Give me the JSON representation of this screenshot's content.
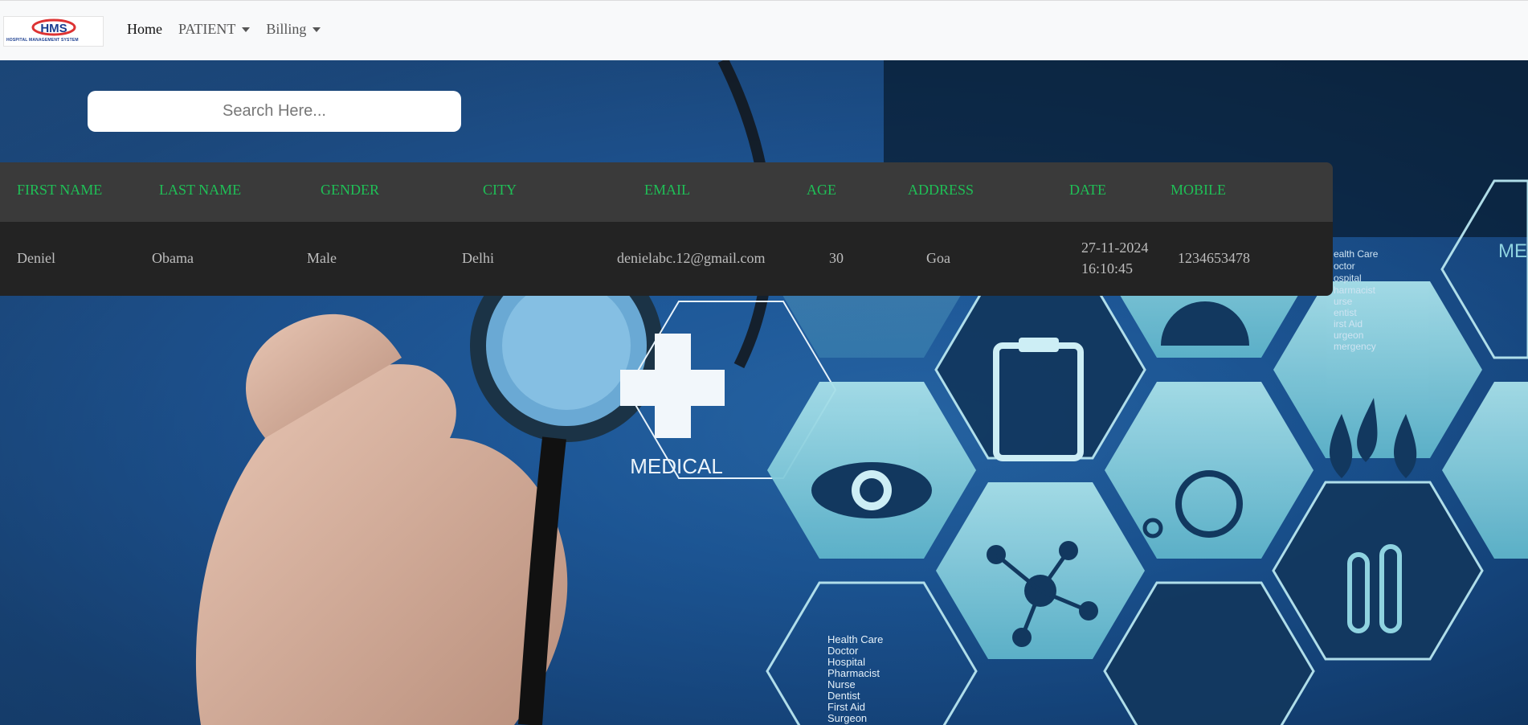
{
  "nav": {
    "logo_text": "HMS",
    "logo_tagline": "HOSPITAL MANAGEMENT SYSTEM",
    "items": [
      {
        "label": "Home"
      },
      {
        "label": "PATIENT"
      },
      {
        "label": "Billing"
      }
    ]
  },
  "search": {
    "placeholder": "Search Here..."
  },
  "table": {
    "headers": [
      "FIRST NAME",
      "LAST NAME",
      "GENDER",
      "CITY",
      "EMAIL",
      "AGE",
      "ADDRESS",
      "DATE",
      "MOBILE"
    ],
    "rows": [
      {
        "first_name": "Deniel",
        "last_name": "Obama",
        "gender": "Male",
        "city": "Delhi",
        "email": "denielabc.12@gmail.com",
        "age": "30",
        "address": "Goa",
        "date": "27-11-2024",
        "time": "16:10:45",
        "mobile": "1234653478"
      }
    ]
  },
  "background": {
    "medical_label": "MEDICAL",
    "list_top": [
      "ealth Care",
      "octor",
      "ospital",
      "harmacist",
      "urse",
      "entist",
      "irst Aid",
      "urgeon",
      "mergency"
    ],
    "list_bottom": [
      "Health Care",
      "Doctor",
      "Hospital",
      "Pharmacist",
      "Nurse",
      "Dentist",
      "First Aid",
      "Surgeon"
    ],
    "corner_text": "ME"
  },
  "colors": {
    "header_text": "#1fbf56",
    "nav_bg": "#f8f9fa",
    "table_head": "#3a3a3a",
    "table_body": "#232323"
  }
}
